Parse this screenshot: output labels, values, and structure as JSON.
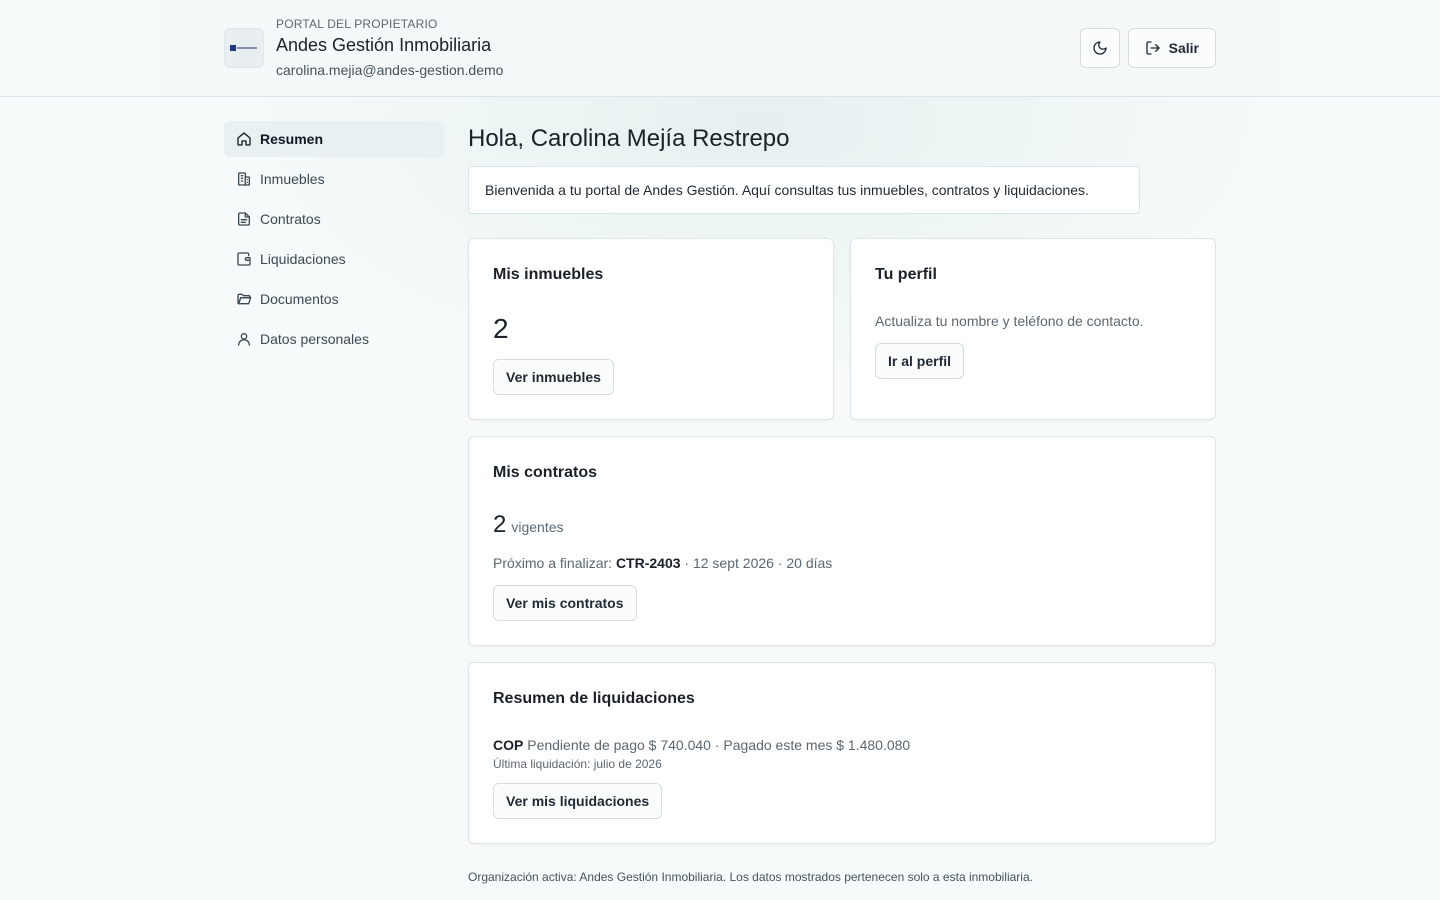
{
  "header": {
    "eyebrow": "PORTAL DEL PROPIETARIO",
    "org_name": "Andes Gestión Inmobiliaria",
    "user_email": "carolina.mejia@andes-gestion.demo",
    "theme_toggle_icon": "moon-icon",
    "logout_label": "Salir",
    "logout_icon": "logout-icon"
  },
  "sidebar": {
    "items": [
      {
        "label": "Resumen",
        "icon": "home-icon",
        "active": true
      },
      {
        "label": "Inmuebles",
        "icon": "building-icon",
        "active": false
      },
      {
        "label": "Contratos",
        "icon": "document-icon",
        "active": false
      },
      {
        "label": "Liquidaciones",
        "icon": "wallet-icon",
        "active": false
      },
      {
        "label": "Documentos",
        "icon": "folder-icon",
        "active": false
      },
      {
        "label": "Datos personales",
        "icon": "user-icon",
        "active": false
      }
    ]
  },
  "main": {
    "greeting": "Hola, Carolina Mejía Restrepo",
    "welcome": "Bienvenida a tu portal de Andes Gestión. Aquí consultas tus inmuebles, contratos y liquidaciones.",
    "inmuebles": {
      "title": "Mis inmuebles",
      "count": "2",
      "button": "Ver inmuebles"
    },
    "perfil": {
      "title": "Tu perfil",
      "text": "Actualiza tu nombre y teléfono de contacto.",
      "button": "Ir al perfil"
    },
    "contratos": {
      "title": "Mis contratos",
      "count": "2",
      "count_suffix": "vigentes",
      "next_prefix": "Próximo a finalizar:",
      "next_code": "CTR-2403",
      "next_detail": "· 12 sept 2026 · 20 días",
      "button": "Ver mis contratos"
    },
    "liquidaciones": {
      "title": "Resumen de liquidaciones",
      "currency": "COP",
      "summary": "Pendiente de pago $ 740.040 · Pagado este mes $ 1.480.080",
      "last": "Última liquidación: julio de 2026",
      "button": "Ver mis liquidaciones"
    },
    "footer": "Organización activa: Andes Gestión Inmobiliaria. Los datos mostrados pertenecen solo a esta inmobiliaria."
  },
  "colors": {
    "background": "#f6fafa",
    "card": "#ffffff",
    "border": "#dde3e6",
    "text": "#1f2933",
    "muted": "#5b6770",
    "active_nav": "#e9f0f1",
    "logo_mark": "#1e3a8a"
  }
}
